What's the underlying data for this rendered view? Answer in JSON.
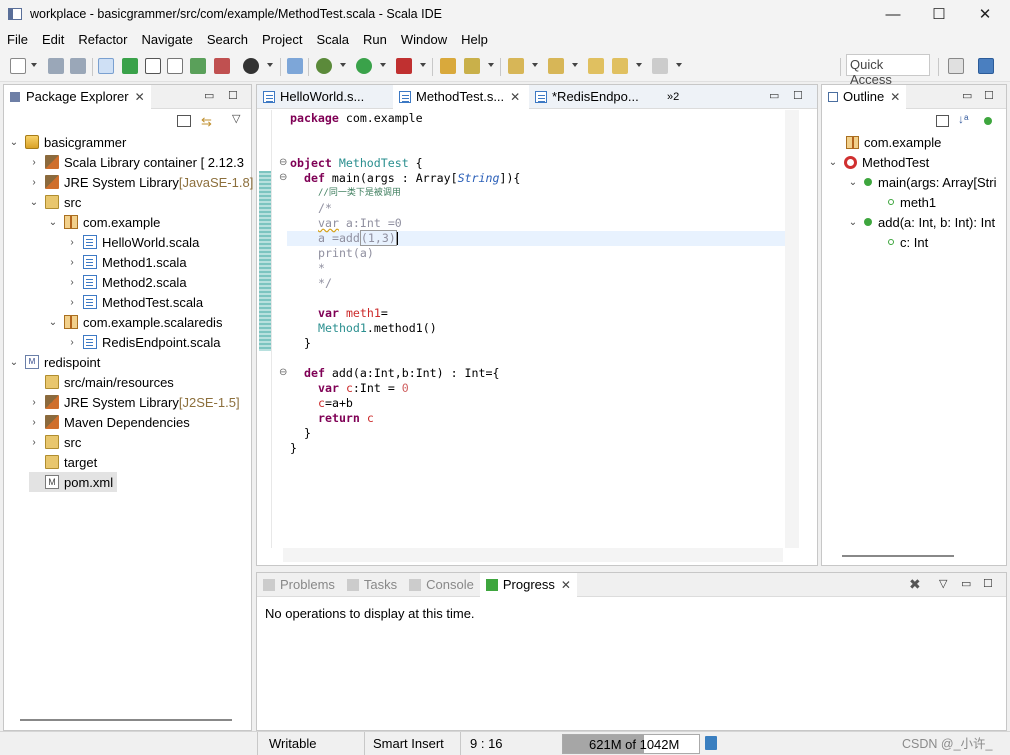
{
  "window": {
    "title": "workplace - basicgrammer/src/com/example/MethodTest.scala - Scala IDE",
    "min": "—",
    "max": "☐",
    "close": "✕"
  },
  "menu": [
    "File",
    "Edit",
    "Refactor",
    "Navigate",
    "Search",
    "Project",
    "Scala",
    "Run",
    "Window",
    "Help"
  ],
  "toolbar": {
    "quick_access": "Quick Access"
  },
  "package_explorer": {
    "tab": "Package Explorer",
    "items": [
      {
        "label": "basicgrammer",
        "icon": "project-icon"
      },
      {
        "label": "Scala Library container [ 2.12.3",
        "icon": "library-icon"
      },
      {
        "label": "JRE System Library ",
        "suffix": "[JavaSE-1.8]",
        "icon": "library-icon"
      },
      {
        "label": "src",
        "icon": "folder-icon"
      },
      {
        "label": "com.example",
        "icon": "package-icon"
      },
      {
        "label": "HelloWorld.scala",
        "icon": "scala-file-icon"
      },
      {
        "label": "Method1.scala",
        "icon": "scala-file-icon"
      },
      {
        "label": "Method2.scala",
        "icon": "scala-file-icon"
      },
      {
        "label": "MethodTest.scala",
        "icon": "scala-file-icon"
      },
      {
        "label": "com.example.scalaredis",
        "icon": "package-icon"
      },
      {
        "label": "RedisEndpoint.scala",
        "icon": "scala-file-icon"
      },
      {
        "label": "redispoint",
        "icon": "maven-project-icon"
      },
      {
        "label": "src/main/resources",
        "icon": "folder-icon"
      },
      {
        "label": "JRE System Library ",
        "suffix": "[J2SE-1.5]",
        "icon": "library-icon"
      },
      {
        "label": "Maven Dependencies",
        "icon": "library-icon"
      },
      {
        "label": "src",
        "icon": "folder-icon"
      },
      {
        "label": "target",
        "icon": "folder-icon"
      },
      {
        "label": "pom.xml",
        "icon": "xml-file-icon"
      }
    ]
  },
  "editor": {
    "tabs": [
      {
        "label": "HelloWorld.s..."
      },
      {
        "label": "MethodTest.s...",
        "close": "✕"
      },
      {
        "label": "*RedisEndpo..."
      }
    ],
    "overflow": "»2",
    "code": {
      "l1": {
        "kw": "package",
        "rest": " com.example"
      },
      "l2": {
        "kw": "object",
        "name": "MethodTest",
        "rest": " {"
      },
      "l3": {
        "kw": "def",
        "a": " main(args : Array[",
        "type": "String",
        "b": "]){"
      },
      "l4": "//同一类下是被调用",
      "l5": "/*",
      "l6": {
        "kw": "var",
        "rest": " a:Int =0"
      },
      "l7": {
        "a": "a =add",
        "b": "(1,3)"
      },
      "l8": "print(a)",
      "l9": "*",
      "l10": "*/",
      "l11": {
        "kw": "var",
        "name": "meth1",
        "rest": "="
      },
      "l12": {
        "name": "Method1",
        "rest": ".method1()"
      },
      "l13": "}",
      "l14": {
        "kw": "def",
        "rest": " add(a:Int,b:Int) : Int={"
      },
      "l15": {
        "kw": "var",
        "name": "c",
        "a": ":Int = ",
        "num": "0"
      },
      "l16": {
        "name": "c",
        "rest": "=a+b"
      },
      "l17": {
        "kw": "return",
        "name": "c"
      },
      "l18": "}",
      "l19": "}"
    }
  },
  "outline": {
    "tab": "Outline",
    "items": [
      {
        "label": "com.example"
      },
      {
        "label": "MethodTest"
      },
      {
        "label": "main(args: Array[Stri"
      },
      {
        "label": "meth1"
      },
      {
        "label": "add(a: Int, b: Int): Int"
      },
      {
        "label": "c: Int"
      }
    ]
  },
  "bottom": {
    "tabs": [
      "Problems",
      "Tasks",
      "Console",
      "Progress"
    ],
    "message": "No operations to display at this time."
  },
  "status": {
    "writable": "Writable",
    "insert": "Smart Insert",
    "position": "9 : 16",
    "heap": "621M of 1042M",
    "heap_fraction": 0.596,
    "watermark": "CSDN @_小许_"
  },
  "colors": {
    "accent": "#3e7ec4",
    "keyword": "#7f0055",
    "selection_line": "#e8f2fe"
  }
}
